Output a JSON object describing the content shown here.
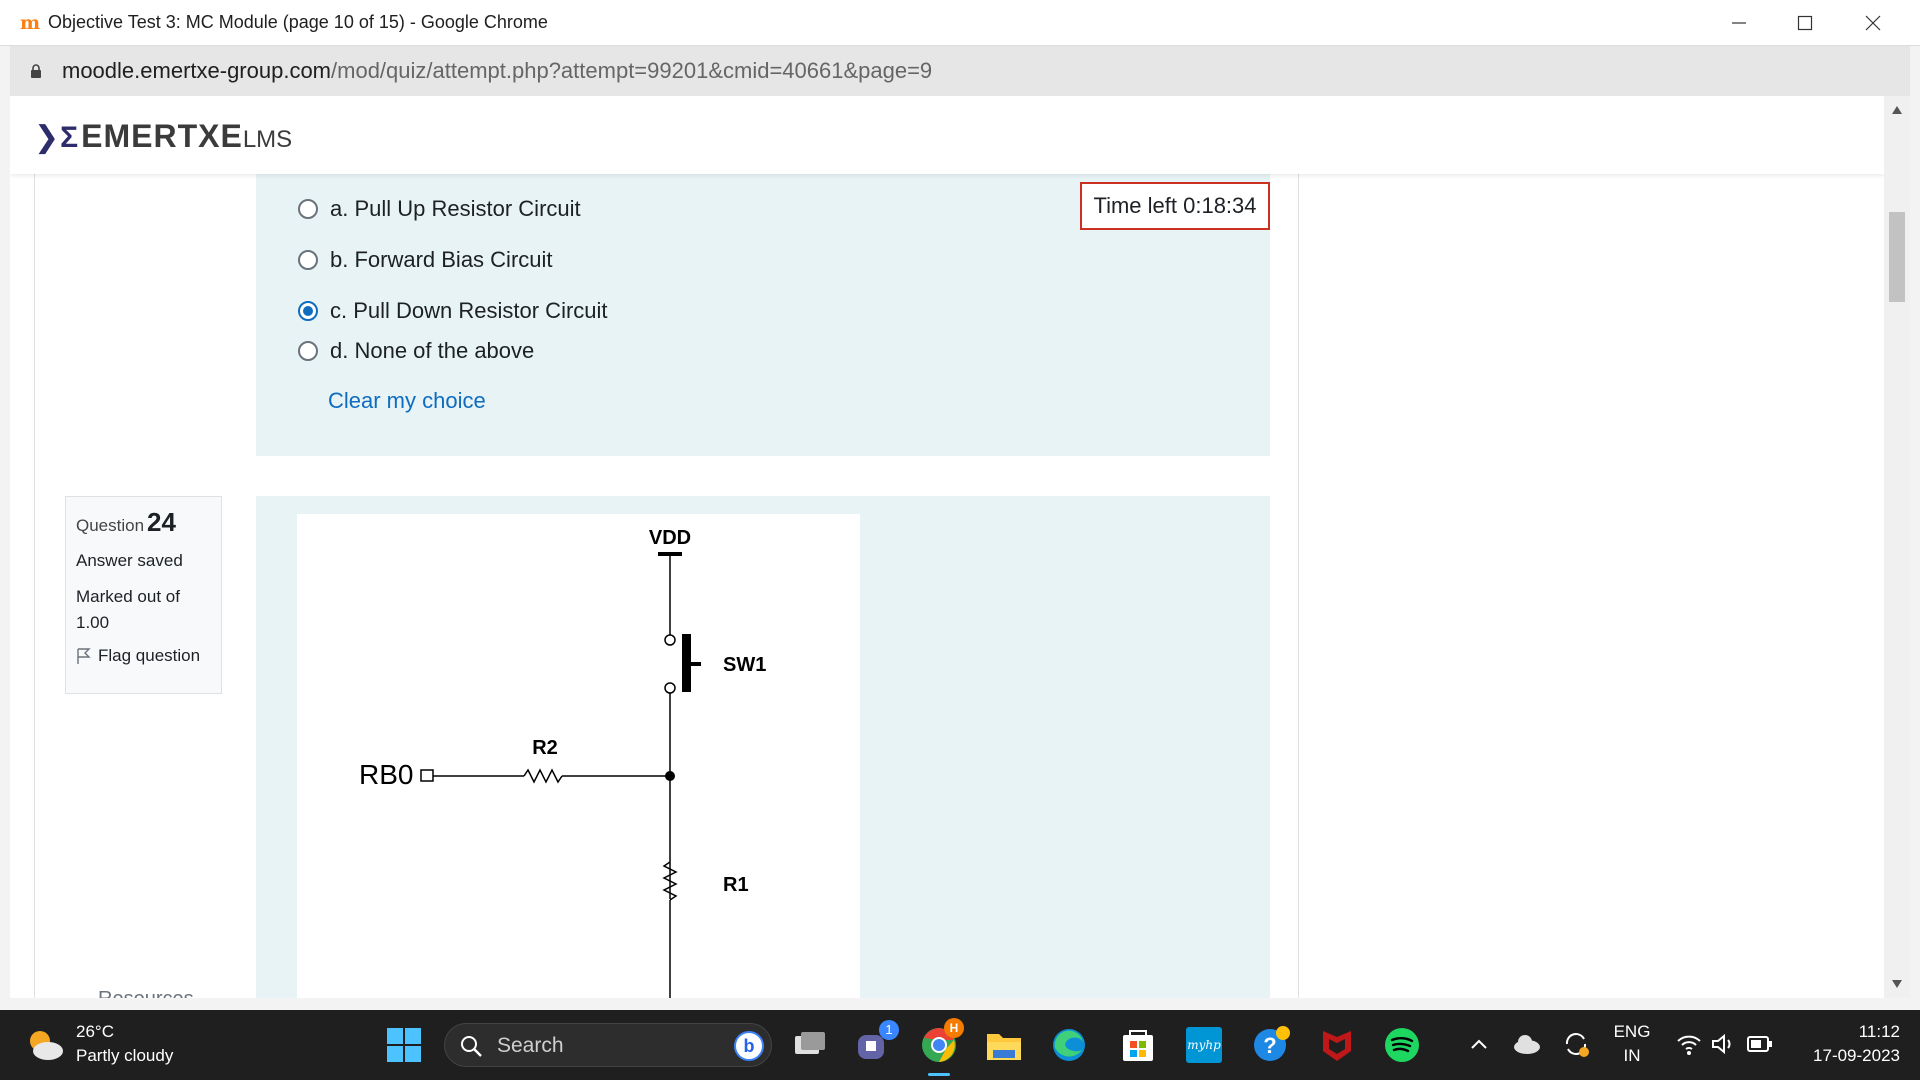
{
  "window": {
    "title": "Objective Test 3: MC Module (page 10 of 15) - Google Chrome",
    "favicon": "moodle-icon",
    "controls": [
      "minimize-icon",
      "maximize-icon",
      "close-icon"
    ]
  },
  "addressbar": {
    "host": "moodle.emertxe-group.com",
    "path": "/mod/quiz/attempt.php?attempt=99201&cmid=40661&page=9"
  },
  "site": {
    "logo_main": "EMERTXE",
    "logo_suffix": "LMS"
  },
  "previous_question": {
    "options": [
      {
        "label": "a. Pull Up Resistor Circuit",
        "selected": false
      },
      {
        "label": "b. Forward Bias Circuit",
        "selected": false
      },
      {
        "label": "c. Pull Down Resistor Circuit",
        "selected": true
      },
      {
        "label": "d. None of the above",
        "selected": false
      }
    ],
    "clear_link": "Clear my choice"
  },
  "timer": {
    "text": "Time left 0:18:34"
  },
  "question_info": {
    "label": "Question",
    "number": "24",
    "status": "Answer saved",
    "marks": "Marked out of 1.00",
    "flag": "Flag question"
  },
  "circuit": {
    "labels": {
      "vdd": "VDD",
      "sw1": "SW1",
      "r2": "R2",
      "rb0": "RB0",
      "r1": "R1"
    }
  },
  "sidebar": {
    "resources": "Resources"
  },
  "taskbar": {
    "weather_temp": "26°C",
    "weather_desc": "Partly cloudy",
    "search_label": "Search",
    "teams_badge": "1",
    "chrome_badge": "H",
    "hp_label": "myhp",
    "lang_top": "ENG",
    "lang_bottom": "IN",
    "time": "11:12",
    "date": "17-09-2023"
  },
  "colors": {
    "panel_bg": "#e7f3f5",
    "link": "#0f6cbf",
    "timer_border": "#ca3120",
    "taskbar_bg": "#1f1f1f"
  }
}
